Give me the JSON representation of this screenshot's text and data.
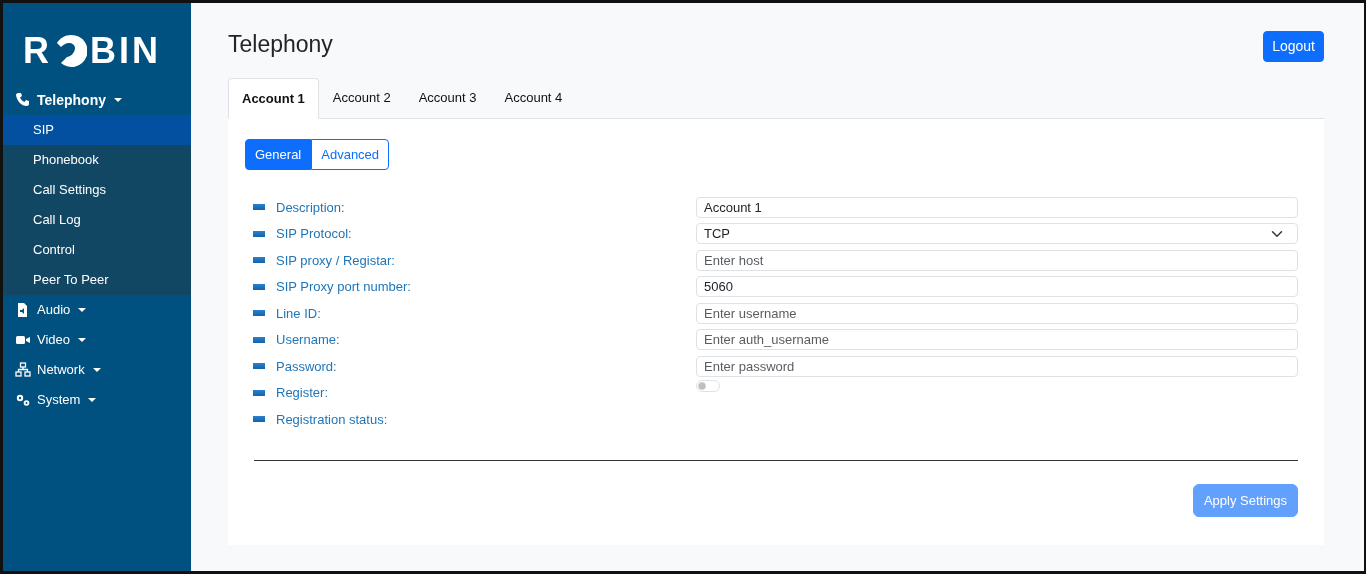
{
  "logo": {
    "before": "R",
    "after": "BIN"
  },
  "sidebar": {
    "items": [
      {
        "label": "Telephony",
        "expanded": true,
        "children": [
          {
            "label": "SIP",
            "selected": true
          },
          {
            "label": "Phonebook",
            "selected": false
          },
          {
            "label": "Call Settings",
            "selected": false
          },
          {
            "label": "Call Log",
            "selected": false
          },
          {
            "label": "Control",
            "selected": false
          },
          {
            "label": "Peer To Peer",
            "selected": false
          }
        ]
      },
      {
        "label": "Audio",
        "expanded": false
      },
      {
        "label": "Video",
        "expanded": false
      },
      {
        "label": "Network",
        "expanded": false
      },
      {
        "label": "System",
        "expanded": false
      }
    ]
  },
  "header": {
    "title": "Telephony",
    "logout": "Logout"
  },
  "tabs": [
    {
      "label": "Account 1",
      "selected": true
    },
    {
      "label": "Account 2",
      "selected": false
    },
    {
      "label": "Account 3",
      "selected": false
    },
    {
      "label": "Account 4",
      "selected": false
    }
  ],
  "subtabs": [
    {
      "label": "General",
      "selected": true
    },
    {
      "label": "Advanced",
      "selected": false
    }
  ],
  "fields": [
    {
      "label": "Description:",
      "kind": "text",
      "value": "Account 1"
    },
    {
      "label": "SIP Protocol:",
      "kind": "select",
      "value": "TCP"
    },
    {
      "label": "SIP proxy / Registar:",
      "kind": "text",
      "placeholder": "Enter host"
    },
    {
      "label": "SIP Proxy port number:",
      "kind": "number",
      "value": "5060"
    },
    {
      "label": "Line ID:",
      "kind": "text",
      "placeholder": "Enter username"
    },
    {
      "label": "Username:",
      "kind": "text",
      "placeholder": "Enter auth_username"
    },
    {
      "label": "Password:",
      "kind": "password",
      "placeholder": "Enter password"
    },
    {
      "label": "Register:",
      "kind": "switch",
      "on": false
    },
    {
      "label": "Registration status:",
      "kind": "status"
    }
  ],
  "apply": {
    "label": "Apply Settings",
    "disabled": true
  }
}
